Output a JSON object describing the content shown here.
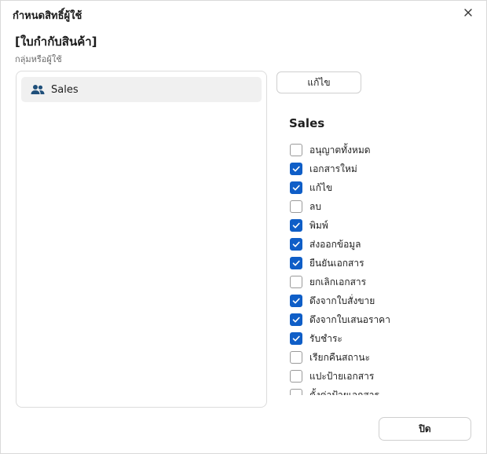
{
  "dialog": {
    "title": "กำหนดสิทธิ์ผู้ใช้",
    "heading": "[ใบกำกับสินค้า]",
    "subtitle": "กลุ่มหรือผู้ใช้"
  },
  "groups": [
    {
      "label": "Sales",
      "icon": "users-icon",
      "selected": true
    }
  ],
  "edit_button": "แก้ไข",
  "permissions": {
    "group_name": "Sales",
    "items": [
      {
        "label": "อนุญาตทั้งหมด",
        "checked": false
      },
      {
        "label": "เอกสารใหม่",
        "checked": true
      },
      {
        "label": "แก้ไข",
        "checked": true
      },
      {
        "label": "ลบ",
        "checked": false
      },
      {
        "label": "พิมพ์",
        "checked": true
      },
      {
        "label": "ส่งออกข้อมูล",
        "checked": true
      },
      {
        "label": "ยืนยันเอกสาร",
        "checked": true
      },
      {
        "label": "ยกเลิกเอกสาร",
        "checked": false
      },
      {
        "label": "ดึงจากใบสั่งขาย",
        "checked": true
      },
      {
        "label": "ดึงจากใบเสนอราคา",
        "checked": true
      },
      {
        "label": "รับชำระ",
        "checked": true
      },
      {
        "label": "เรียกคืนสถานะ",
        "checked": false
      },
      {
        "label": "แปะป้ายเอกสาร",
        "checked": false
      },
      {
        "label": "ตั้งค่าป้ายเอกสาร",
        "checked": false
      }
    ]
  },
  "close_button": "ปิด",
  "colors": {
    "accent": "#0f5ec7",
    "icon": "#1f4f7a"
  }
}
